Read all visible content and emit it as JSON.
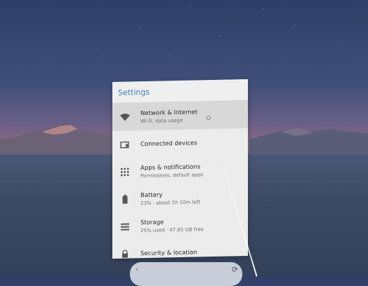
{
  "panel": {
    "title": "Settings",
    "items": [
      {
        "title": "Network & Internet",
        "subtitle": "Wi-Fi, data usage",
        "icon": "wifi-icon",
        "active": true
      },
      {
        "title": "Connected devices",
        "subtitle": "",
        "icon": "connected-devices-icon",
        "active": false
      },
      {
        "title": "Apps & notifications",
        "subtitle": "Permissions, default apps",
        "icon": "apps-grid-icon",
        "active": false
      },
      {
        "title": "Battery",
        "subtitle": "23% · about 1h 10m left",
        "icon": "battery-icon",
        "active": false
      },
      {
        "title": "Storage",
        "subtitle": "25% used · 47.85 GB free",
        "icon": "storage-icon",
        "active": false
      },
      {
        "title": "Security & location",
        "subtitle": "",
        "icon": "lock-icon",
        "active": false
      }
    ]
  },
  "bottom_bar": {
    "left_glyph": "‹",
    "right_glyph": "⟳"
  },
  "colors": {
    "accent": "#3f7fc3",
    "panel_bg": "#ececec",
    "active_row": "#d8d8d8"
  }
}
